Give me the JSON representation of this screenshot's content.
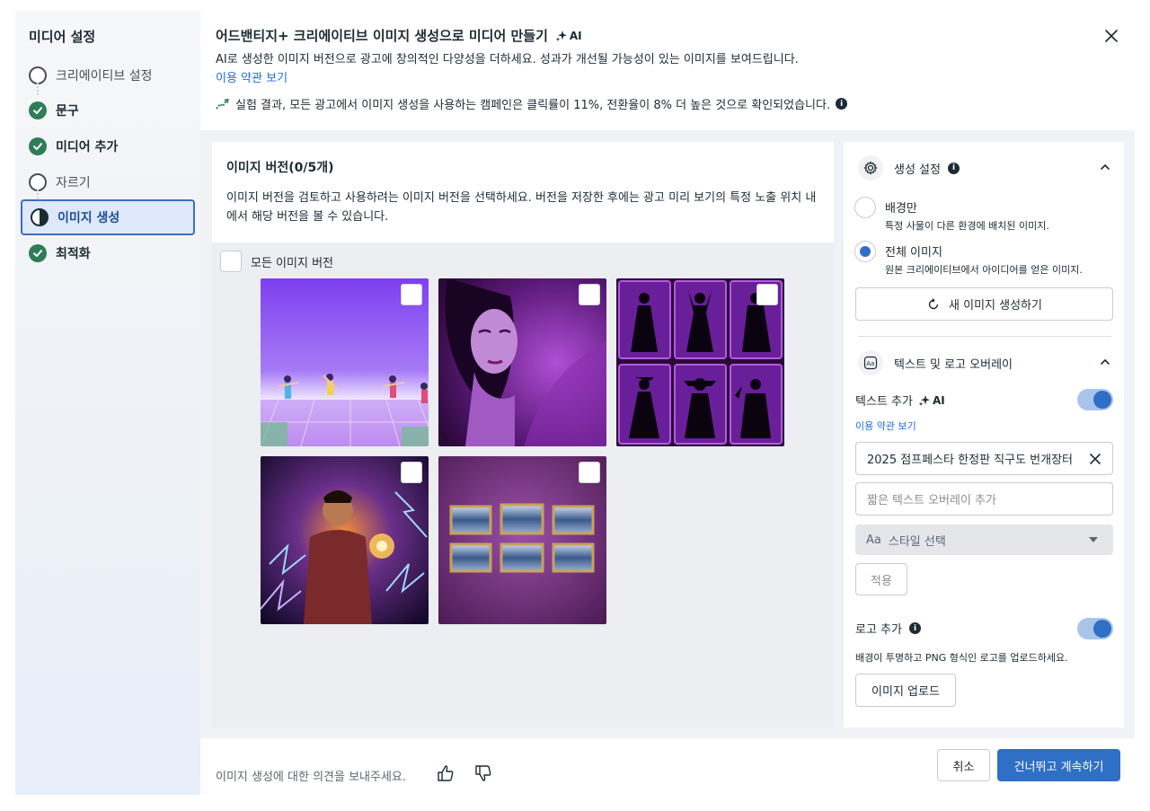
{
  "sidebar": {
    "title": "미디어 설정",
    "steps": [
      {
        "label": "크리에이티브 설정",
        "status": "empty"
      },
      {
        "label": "문구",
        "status": "done"
      },
      {
        "label": "미디어 추가",
        "status": "done"
      },
      {
        "label": "자르기",
        "status": "empty"
      },
      {
        "label": "이미지 생성",
        "status": "active"
      },
      {
        "label": "최적화",
        "status": "done"
      }
    ]
  },
  "header": {
    "title": "어드밴티지+ 크리에이티브 이미지 생성으로 미디어 만들기",
    "ai_badge": "AI",
    "description": "AI로 생성한 이미지 버전으로 광고에 창의적인 다양성을 더하세요. 성과가 개선될 가능성이 있는 이미지를 보여드립니다.",
    "terms_link": "이용 약관 보기",
    "stat_text": "실험 결과, 모든 광고에서 이미지 생성을 사용하는 캠페인은 클릭률이 11%, 전환율이 8% 더 높은 것으로 확인되었습니다."
  },
  "versions": {
    "title": "이미지 버전(0/5개)",
    "description": "이미지 버전을 검토하고 사용하려는 이미지 버전을 선택하세요. 버전을 저장한 후에는 광고 미리 보기의 특정 노출 위치 내에서 해당 버전을 볼 수 있습니다.",
    "select_all_label": "모든 이미지 버전",
    "images": [
      {
        "name": "dancers-neon-floor",
        "selected": false
      },
      {
        "name": "woman-purple-portrait",
        "selected": false
      },
      {
        "name": "silhouette-frames",
        "selected": false
      },
      {
        "name": "man-lightning-energy",
        "selected": false
      },
      {
        "name": "framed-paintings-wall",
        "selected": false
      }
    ]
  },
  "settings": {
    "generation": {
      "title": "생성 설정",
      "options": [
        {
          "title": "배경만",
          "subtitle": "특정 사물이 다른 환경에 배치된 이미지.",
          "selected": false
        },
        {
          "title": "전체 이미지",
          "subtitle": "원본 크리에이티브에서 아이디어를 얻은 이미지.",
          "selected": true
        }
      ],
      "generate_button": "새 이미지 생성하기"
    },
    "overlay": {
      "title": "텍스트 및 로고 오버레이",
      "text_add_label": "텍스트 추가",
      "text_ai_badge": "AI",
      "text_toggle_on": true,
      "terms_link": "이용 약관 보기",
      "text_value": "2025 점프페스타 한정판 직구도 번개장터",
      "text_placeholder": "짧은 텍스트 오버레이 추가",
      "style_select_icon": "Aa",
      "style_select_label": "스타일 선택",
      "apply_button": "적용",
      "logo_add_label": "로고 추가",
      "logo_toggle_on": true,
      "logo_hint": "배경이 투명하고 PNG 형식인 로고를 업로드하세요.",
      "upload_button": "이미지 업로드"
    }
  },
  "footer": {
    "feedback_text": "이미지 생성에 대한 의견을 보내주세요.",
    "cancel_button": "취소",
    "continue_button": "건너뛰고 계속하기"
  },
  "colors": {
    "primary": "#2f6fc6",
    "link": "#216fdb",
    "success": "#2f7d56",
    "active_step_bg": "#dde8fa"
  }
}
